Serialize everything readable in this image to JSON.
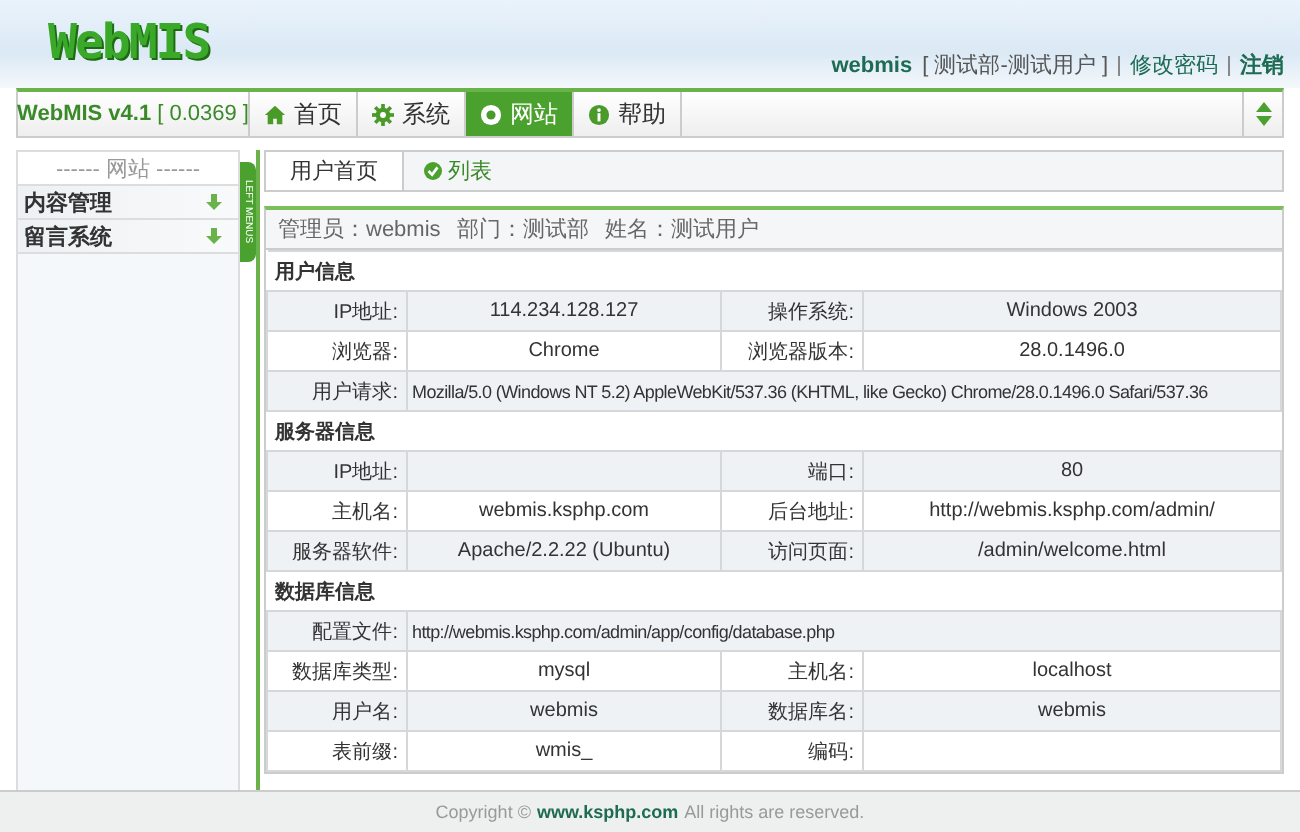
{
  "header": {
    "logo": "WebMIS",
    "user": "webmis",
    "dept": "[ 测试部-测试用户 ]",
    "links": [
      {
        "label": "修改密码",
        "kind": "plain"
      },
      {
        "label": "注销",
        "kind": "bold"
      }
    ]
  },
  "nav": {
    "version": "WebMIS v4.1",
    "timing": "[ 0.0369 ]",
    "items": [
      {
        "label": "首页",
        "selected": false
      },
      {
        "label": "系统",
        "selected": false
      },
      {
        "label": "网站",
        "selected": true
      },
      {
        "label": "帮助",
        "selected": false
      }
    ]
  },
  "sidebar": {
    "title": "------ 网站 ------",
    "toggle": "LEFT MENUS",
    "items": [
      {
        "label": "内容管理"
      },
      {
        "label": "留言系统"
      }
    ]
  },
  "tabs": [
    {
      "label": "用户首页",
      "kind": "tab"
    },
    {
      "label": "列表",
      "kind": "link"
    }
  ],
  "info_line": [
    "管理员：webmis",
    "部门：测试部",
    "姓名：测试用户"
  ],
  "sections": [
    {
      "title": "用户信息",
      "rows": [
        {
          "kind": "pair",
          "items": [
            {
              "label": "IP地址:",
              "value": "114.234.128.127"
            },
            {
              "label": "操作系统:",
              "value": "Windows 2003"
            }
          ]
        },
        {
          "kind": "pair",
          "items": [
            {
              "label": "浏览器:",
              "value": "Chrome"
            },
            {
              "label": "浏览器版本:",
              "value": "28.0.1496.0"
            }
          ]
        },
        {
          "kind": "wide",
          "items": [
            {
              "label": "用户请求:",
              "value": "Mozilla/5.0 (Windows NT 5.2) AppleWebKit/537.36 (KHTML, like Gecko) Chrome/28.0.1496.0 Safari/537.36"
            }
          ]
        }
      ]
    },
    {
      "title": "服务器信息",
      "rows": [
        {
          "kind": "pair",
          "items": [
            {
              "label": "IP地址:"
            },
            {
              "label": "端口:",
              "value": "80"
            }
          ]
        },
        {
          "kind": "pair",
          "items": [
            {
              "label": "主机名:",
              "value": "webmis.ksphp.com"
            },
            {
              "label": "后台地址:",
              "value": "http://webmis.ksphp.com/admin/"
            }
          ]
        },
        {
          "kind": "pair",
          "items": [
            {
              "label": "服务器软件:",
              "value": "Apache/2.2.22 (Ubuntu)"
            },
            {
              "label": "访问页面:",
              "value": "/admin/welcome.html"
            }
          ]
        }
      ]
    },
    {
      "title": "数据库信息",
      "rows": [
        {
          "kind": "wide",
          "items": [
            {
              "label": "配置文件:",
              "value": "http://webmis.ksphp.com/admin/app/config/database.php"
            }
          ]
        },
        {
          "kind": "pair",
          "items": [
            {
              "label": "数据库类型:",
              "value": "mysql"
            },
            {
              "label": "主机名:",
              "value": "localhost"
            }
          ]
        },
        {
          "kind": "pair",
          "items": [
            {
              "label": "用户名:",
              "value": "webmis"
            },
            {
              "label": "数据库名:",
              "value": "webmis"
            }
          ]
        },
        {
          "kind": "pair",
          "items": [
            {
              "label": "表前缀:",
              "value": "wmis_"
            },
            {
              "label": "编码:"
            }
          ]
        }
      ]
    }
  ],
  "footer": {
    "prefix": "Copyright ©",
    "link": "www.ksphp.com",
    "suffix": "All rights are reserved."
  }
}
